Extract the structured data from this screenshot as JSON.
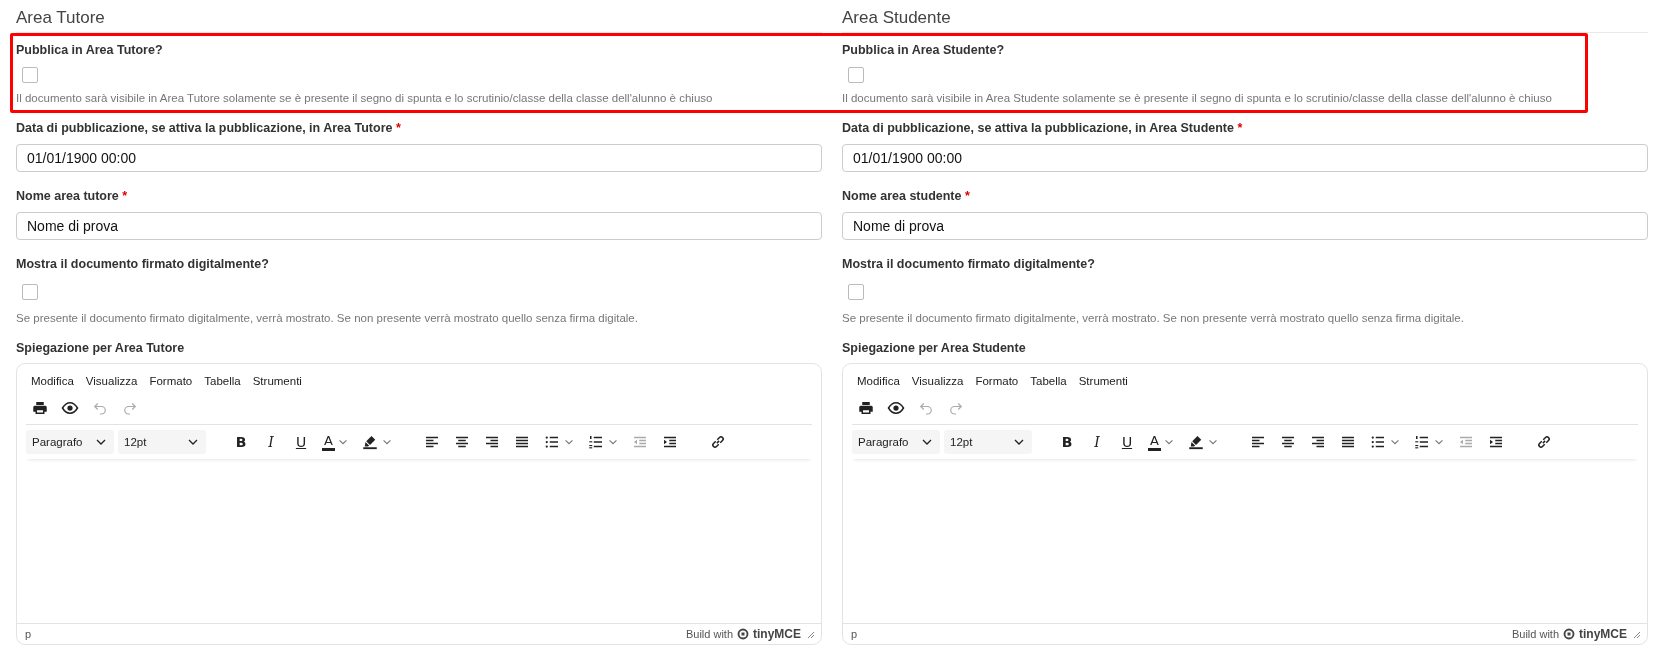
{
  "columns": [
    {
      "heading": "Area Tutore",
      "publish": {
        "label": "Pubblica in Area Tutore?",
        "checked": false,
        "help": "Il documento sarà visibile in Area Tutore solamente se è presente il segno di spunta e lo scrutinio/classe della classe dell'alunno è chiuso"
      },
      "date": {
        "label": "Data di pubblicazione, se attiva la pubblicazione, in Area Tutore",
        "required_mark": "*",
        "value": "01/01/1900 00:00"
      },
      "name": {
        "label": "Nome area tutore",
        "required_mark": "*",
        "value": "Nome di prova"
      },
      "signed": {
        "label": "Mostra il documento firmato digitalmente?",
        "checked": false,
        "help": "Se presente il documento firmato digitalmente, verrà mostrato. Se non presente verrà mostrato quello senza firma digitale."
      },
      "explanation": {
        "label": "Spiegazione per Area Tutore",
        "editor": {
          "menu": [
            "Modifica",
            "Visualizza",
            "Formato",
            "Tabella",
            "Strumenti"
          ],
          "toolbar_top": [
            {
              "kind": "print",
              "disabled": false
            },
            {
              "kind": "preview",
              "disabled": false
            },
            {
              "kind": "undo",
              "disabled": true
            },
            {
              "kind": "redo",
              "disabled": true
            }
          ],
          "toolbar": [
            {
              "kind": "select",
              "text": "Paragrafo"
            },
            {
              "kind": "select",
              "text": "12pt"
            },
            {
              "kind": "bold",
              "text": "B"
            },
            {
              "kind": "italic",
              "text": "I"
            },
            {
              "kind": "underline",
              "text": "U"
            },
            {
              "kind": "text-color",
              "text": "A"
            },
            {
              "kind": "highlight",
              "disabled": false
            },
            {
              "kind": "align-left",
              "disabled": false
            },
            {
              "kind": "align-center",
              "disabled": false
            },
            {
              "kind": "align-right",
              "disabled": false
            },
            {
              "kind": "justify",
              "disabled": false
            },
            {
              "kind": "bullet-list",
              "disabled": false
            },
            {
              "kind": "numbered-list",
              "disabled": false
            },
            {
              "kind": "outdent",
              "disabled": true
            },
            {
              "kind": "indent",
              "disabled": false
            },
            {
              "kind": "link",
              "disabled": false
            }
          ],
          "path": "p",
          "branding": "Build with",
          "brand": "tinyMCE"
        }
      }
    },
    {
      "heading": "Area Studente",
      "publish": {
        "label": "Pubblica in Area Studente?",
        "checked": false,
        "help": "Il documento sarà visibile in Area Studente solamente se è presente il segno di spunta e lo scrutinio/classe della classe dell'alunno è chiuso"
      },
      "date": {
        "label": "Data di pubblicazione, se attiva la pubblicazione, in Area Studente",
        "required_mark": "*",
        "value": "01/01/1900 00:00"
      },
      "name": {
        "label": "Nome area studente",
        "required_mark": "*",
        "value": "Nome di prova"
      },
      "signed": {
        "label": "Mostra il documento firmato digitalmente?",
        "checked": false,
        "help": "Se presente il documento firmato digitalmente, verrà mostrato. Se non presente verrà mostrato quello senza firma digitale."
      },
      "explanation": {
        "label": "Spiegazione per Area Studente",
        "editor": {
          "menu": [
            "Modifica",
            "Visualizza",
            "Formato",
            "Tabella",
            "Strumenti"
          ],
          "toolbar_top": [
            {
              "kind": "print",
              "disabled": false
            },
            {
              "kind": "preview",
              "disabled": false
            },
            {
              "kind": "undo",
              "disabled": true
            },
            {
              "kind": "redo",
              "disabled": true
            }
          ],
          "toolbar": [
            {
              "kind": "select",
              "text": "Paragrafo"
            },
            {
              "kind": "select",
              "text": "12pt"
            },
            {
              "kind": "bold",
              "text": "B"
            },
            {
              "kind": "italic",
              "text": "I"
            },
            {
              "kind": "underline",
              "text": "U"
            },
            {
              "kind": "text-color",
              "text": "A"
            },
            {
              "kind": "highlight",
              "disabled": false
            },
            {
              "kind": "align-left",
              "disabled": false
            },
            {
              "kind": "align-center",
              "disabled": false
            },
            {
              "kind": "align-right",
              "disabled": false
            },
            {
              "kind": "justify",
              "disabled": false
            },
            {
              "kind": "bullet-list",
              "disabled": false
            },
            {
              "kind": "numbered-list",
              "disabled": false
            },
            {
              "kind": "outdent",
              "disabled": true
            },
            {
              "kind": "indent",
              "disabled": false
            },
            {
              "kind": "link",
              "disabled": false
            }
          ],
          "path": "p",
          "branding": "Build with",
          "brand": "tinyMCE"
        }
      }
    }
  ]
}
